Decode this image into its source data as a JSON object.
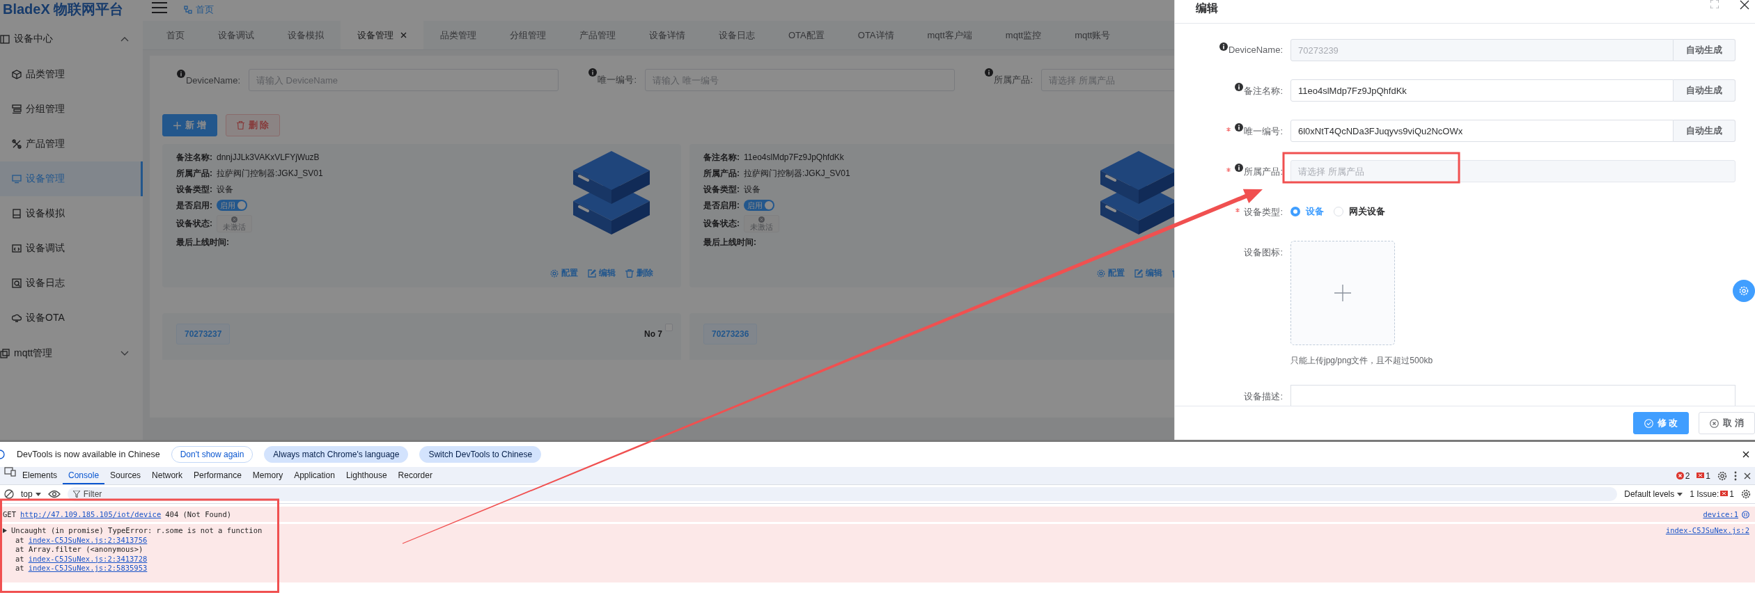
{
  "app": {
    "logo": "BladeX 物联网平台",
    "breadcrumb": "首页"
  },
  "sidebar": {
    "groups": [
      {
        "label": "设备中心",
        "expanded": true,
        "children": [
          {
            "label": "品类管理",
            "selected": false
          },
          {
            "label": "分组管理",
            "selected": false
          },
          {
            "label": "产品管理",
            "selected": false
          },
          {
            "label": "设备管理",
            "selected": true
          },
          {
            "label": "设备模拟",
            "selected": false
          },
          {
            "label": "设备调试",
            "selected": false
          },
          {
            "label": "设备日志",
            "selected": false
          },
          {
            "label": "设备OTA",
            "selected": false
          }
        ]
      },
      {
        "label": "mqtt管理",
        "expanded": false
      }
    ]
  },
  "tabs": [
    {
      "label": "首页",
      "selected": false
    },
    {
      "label": "设备调试",
      "selected": false
    },
    {
      "label": "设备模拟",
      "selected": false
    },
    {
      "label": "设备管理",
      "selected": true
    },
    {
      "label": "品类管理",
      "selected": false
    },
    {
      "label": "分组管理",
      "selected": false
    },
    {
      "label": "产品管理",
      "selected": false
    },
    {
      "label": "设备详情",
      "selected": false
    },
    {
      "label": "设备日志",
      "selected": false
    },
    {
      "label": "OTA配置",
      "selected": false
    },
    {
      "label": "OTA详情",
      "selected": false
    },
    {
      "label": "mqtt客户端",
      "selected": false
    },
    {
      "label": "mqtt监控",
      "selected": false
    },
    {
      "label": "mqtt账号",
      "selected": false
    }
  ],
  "filters": [
    {
      "label": "DeviceName:",
      "placeholder": "请输入 DeviceName"
    },
    {
      "label": "唯一编号:",
      "placeholder": "请输入 唯一编号"
    },
    {
      "label": "所属产品:",
      "placeholder": "请选择 所属产品"
    }
  ],
  "actions": [
    {
      "label": "新 增",
      "kind": "primary"
    },
    {
      "label": "删 除",
      "kind": "danger"
    }
  ],
  "cards": [
    {
      "kind": "detail",
      "fields": [
        {
          "label": "备注名称:",
          "kind": "text",
          "value": "dnnjJJLk3VAKxVLFYjWuzB"
        },
        {
          "label": "所属产品:",
          "kind": "text",
          "value": "拉萨阀门控制器:JGKJ_SV01"
        },
        {
          "label": "设备类型:",
          "kind": "text",
          "value": "设备"
        },
        {
          "label": "是否启用:",
          "kind": "switch",
          "value": "启用",
          "on": true
        },
        {
          "label": "设备状态:",
          "kind": "status",
          "value": "未激活"
        },
        {
          "label": "最后上线时间:",
          "kind": "text"
        }
      ],
      "links": [
        {
          "label": "配置",
          "kind": "config"
        },
        {
          "label": "编辑",
          "kind": "edit"
        },
        {
          "label": "删除",
          "kind": "delete"
        }
      ]
    },
    {
      "kind": "detail",
      "fields": [
        {
          "label": "备注名称:",
          "kind": "text",
          "value": "11eo4slMdp7Fz9JpQhfdKk"
        },
        {
          "label": "所属产品:",
          "kind": "text",
          "value": "拉萨阀门控制器:JGKJ_SV01"
        },
        {
          "label": "设备类型:",
          "kind": "text",
          "value": "设备"
        },
        {
          "label": "是否启用:",
          "kind": "switch",
          "value": "启用",
          "on": true
        },
        {
          "label": "设备状态:",
          "kind": "status",
          "value": "未激活"
        },
        {
          "label": "最后上线时间:",
          "kind": "text"
        }
      ],
      "links": [
        {
          "label": "配置",
          "kind": "config"
        },
        {
          "label": "编辑",
          "kind": "edit"
        },
        {
          "kind": "delete"
        }
      ]
    },
    {
      "kind": "header",
      "tag": "70273237",
      "number": "No 7",
      "checked": false
    },
    {
      "kind": "header",
      "tag": "70273236"
    }
  ],
  "drawer": {
    "title": "编辑",
    "fields": [
      {
        "label": "DeviceName:",
        "kind": "input",
        "info": true,
        "required": false,
        "disabled": true,
        "value": "70273239",
        "append": "自动生成"
      },
      {
        "label": "备注名称:",
        "kind": "input",
        "info": true,
        "required": false,
        "disabled": false,
        "value": "11eo4slMdp7Fz9JpQhfdKk",
        "append": "自动生成"
      },
      {
        "label": "唯一编号:",
        "kind": "input",
        "info": true,
        "required": true,
        "disabled": false,
        "value": "6l0xNtT4QcNDa3FJuqyvs9viQu2NcOWx",
        "append": "自动生成"
      },
      {
        "label": "所属产品:",
        "kind": "select",
        "info": true,
        "required": true,
        "disabled": true,
        "placeholder": "请选择 所属产品"
      },
      {
        "label": "设备类型:",
        "kind": "radio",
        "info": false,
        "required": true,
        "options": [
          {
            "label": "设备",
            "selected": true
          },
          {
            "label": "网关设备",
            "selected": false
          }
        ]
      },
      {
        "label": "设备图标:",
        "kind": "upload",
        "info": false,
        "required": false,
        "hint": "只能上传jpg/png文件，且不超过500kb"
      },
      {
        "label": "设备描述:",
        "kind": "editor",
        "info": false,
        "required": false
      }
    ],
    "buttons": [
      {
        "label": "修 改",
        "kind": "primary"
      },
      {
        "label": "取 消",
        "kind": "default"
      }
    ]
  },
  "devtools": {
    "infobar": {
      "message": "DevTools is now available in Chinese",
      "buttons": [
        {
          "label": "Don't show again",
          "kind": "outline"
        },
        {
          "label": "Always match Chrome's language",
          "kind": "filled"
        },
        {
          "label": "Switch DevTools to Chinese",
          "kind": "filled"
        }
      ]
    },
    "tabs": [
      {
        "label": "Elements",
        "selected": false
      },
      {
        "label": "Console",
        "selected": true
      },
      {
        "label": "Sources",
        "selected": false
      },
      {
        "label": "Network",
        "selected": false
      },
      {
        "label": "Performance",
        "selected": false
      },
      {
        "label": "Memory",
        "selected": false
      },
      {
        "label": "Application",
        "selected": false
      },
      {
        "label": "Lighthouse",
        "selected": false
      },
      {
        "label": "Recorder",
        "selected": false
      }
    ],
    "error_count": "2",
    "issue_count": "1",
    "context": "top",
    "filter_placeholder": "Filter",
    "levels": "Default levels",
    "issues_label": "1 Issue:",
    "issues_badge": "1",
    "messages": [
      {
        "kind": "network",
        "method": "GET",
        "url": "http://47.109.185.105/iot/device",
        "status": "404 (Not Found)",
        "source": "device:1"
      },
      {
        "kind": "error",
        "expanded": true,
        "text": "Uncaught (in promise) TypeError: r.some is not a function",
        "source": "index-C5JSuNex.js:2",
        "stack": [
          {
            "prefix": "at",
            "link": "index-C5JSuNex.js:2:3413756"
          },
          {
            "text": "at Array.filter (<anonymous>)"
          },
          {
            "prefix": "at",
            "link": "index-C5JSuNex.js:2:3413728"
          },
          {
            "prefix": "at",
            "link": "index-C5JSuNex.js:2:5835953"
          }
        ]
      }
    ]
  },
  "annotations": {
    "frame_product_field": true,
    "frame_console_errors": true,
    "arrow": true
  }
}
